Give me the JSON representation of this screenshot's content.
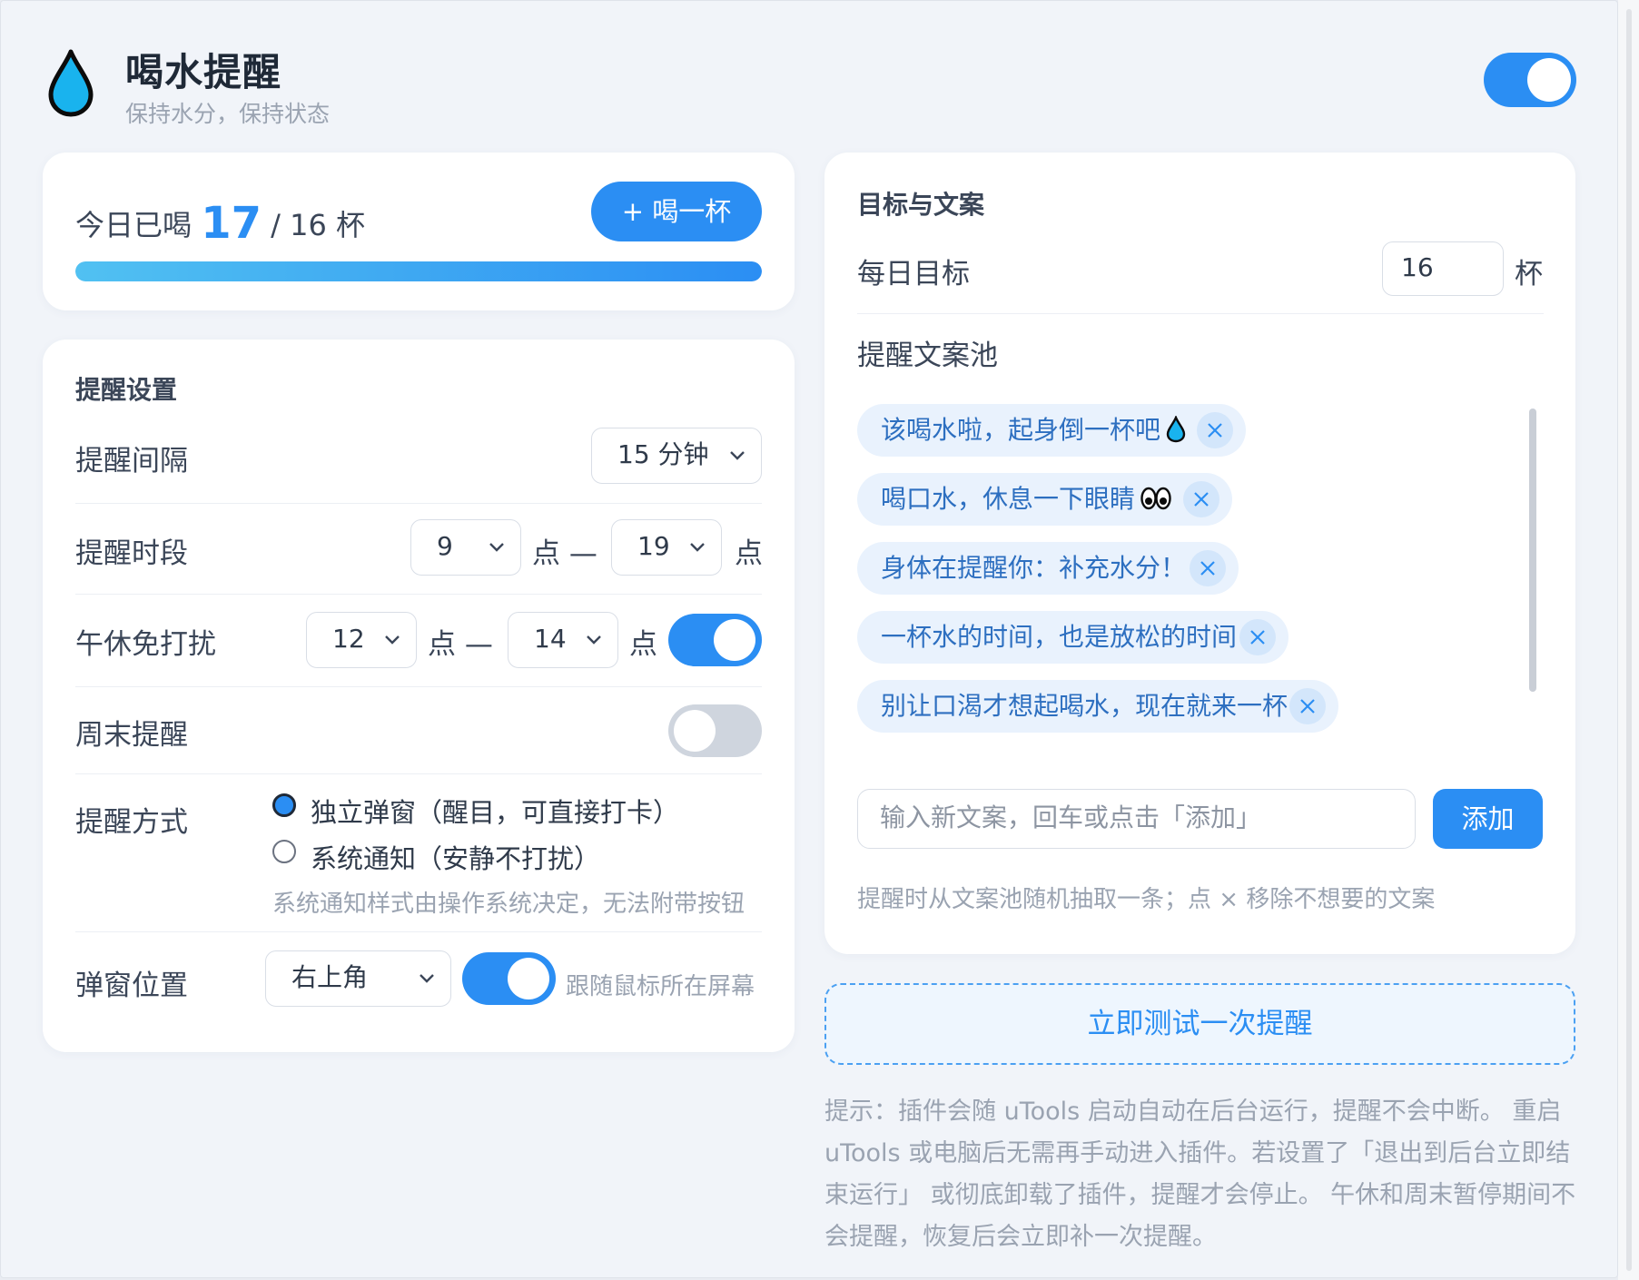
{
  "header": {
    "title": "喝水提醒",
    "subtitle": "保持水分，保持状态",
    "master_enabled": true
  },
  "progress": {
    "label_prefix": "今日已喝",
    "count": "17",
    "separator": "/ 16 杯",
    "fraction": 1.0,
    "drink_button_label": "+ 喝一杯"
  },
  "reminder_settings": {
    "title": "提醒设置",
    "interval": {
      "label": "提醒间隔",
      "value": "15 分钟"
    },
    "period": {
      "label": "提醒时段",
      "start": "9",
      "end": "19",
      "unit": "点",
      "dash": "—"
    },
    "lunch_break": {
      "label": "午休免打扰",
      "start": "12",
      "end": "14",
      "unit": "点",
      "dash": "—",
      "enabled": true
    },
    "weekend": {
      "label": "周末提醒",
      "enabled": false
    },
    "method": {
      "label": "提醒方式",
      "options": [
        "独立弹窗（醒目，可直接打卡）",
        "系统通知（安静不打扰）"
      ],
      "selected": 0,
      "hint": "系统通知样式由操作系统决定，无法附带按钮"
    },
    "popup_position": {
      "label": "弹窗位置",
      "value": "右上角",
      "follow_mouse": true,
      "follow_label": "跟随鼠标所在屏幕"
    }
  },
  "goals": {
    "title": "目标与文案",
    "daily_goal": {
      "label": "每日目标",
      "value": "16",
      "unit": "杯"
    },
    "pool": {
      "label": "提醒文案池",
      "items": [
        {
          "text": "该喝水啦，起身倒一杯吧",
          "icon": "water-drop-icon"
        },
        {
          "text": "喝口水，休息一下眼睛",
          "icon": "eyes-icon"
        },
        {
          "text": "身体在提醒你：补充水分！",
          "icon": ""
        },
        {
          "text": "一杯水的时间，也是放松的时间",
          "icon": ""
        },
        {
          "text": "别让口渴才想起喝水，现在就来一杯",
          "icon": ""
        }
      ]
    },
    "new_text_placeholder": "输入新文案，回车或点击「添加」",
    "add_button_label": "添加",
    "hint": "提醒时从文案池随机抽取一条；点 × 移除不想要的文案"
  },
  "test_button_label": "立即测试一次提醒",
  "tip": "提示：插件会随 uTools 启动自动在后台运行，提醒不会中断。 重启 uTools 或电脑后无需再手动进入插件。若设置了「退出到后台立即结束运行」 或彻底卸载了插件，提醒才会停止。 午休和周末暂停期间不会提醒，恢复后会立即补一次提醒。",
  "colors": {
    "accent": "#2b8ef3",
    "chip_bg": "#e9f2fd",
    "chip_text": "#2d6fc0",
    "toggle_off": "#cfd5de"
  }
}
